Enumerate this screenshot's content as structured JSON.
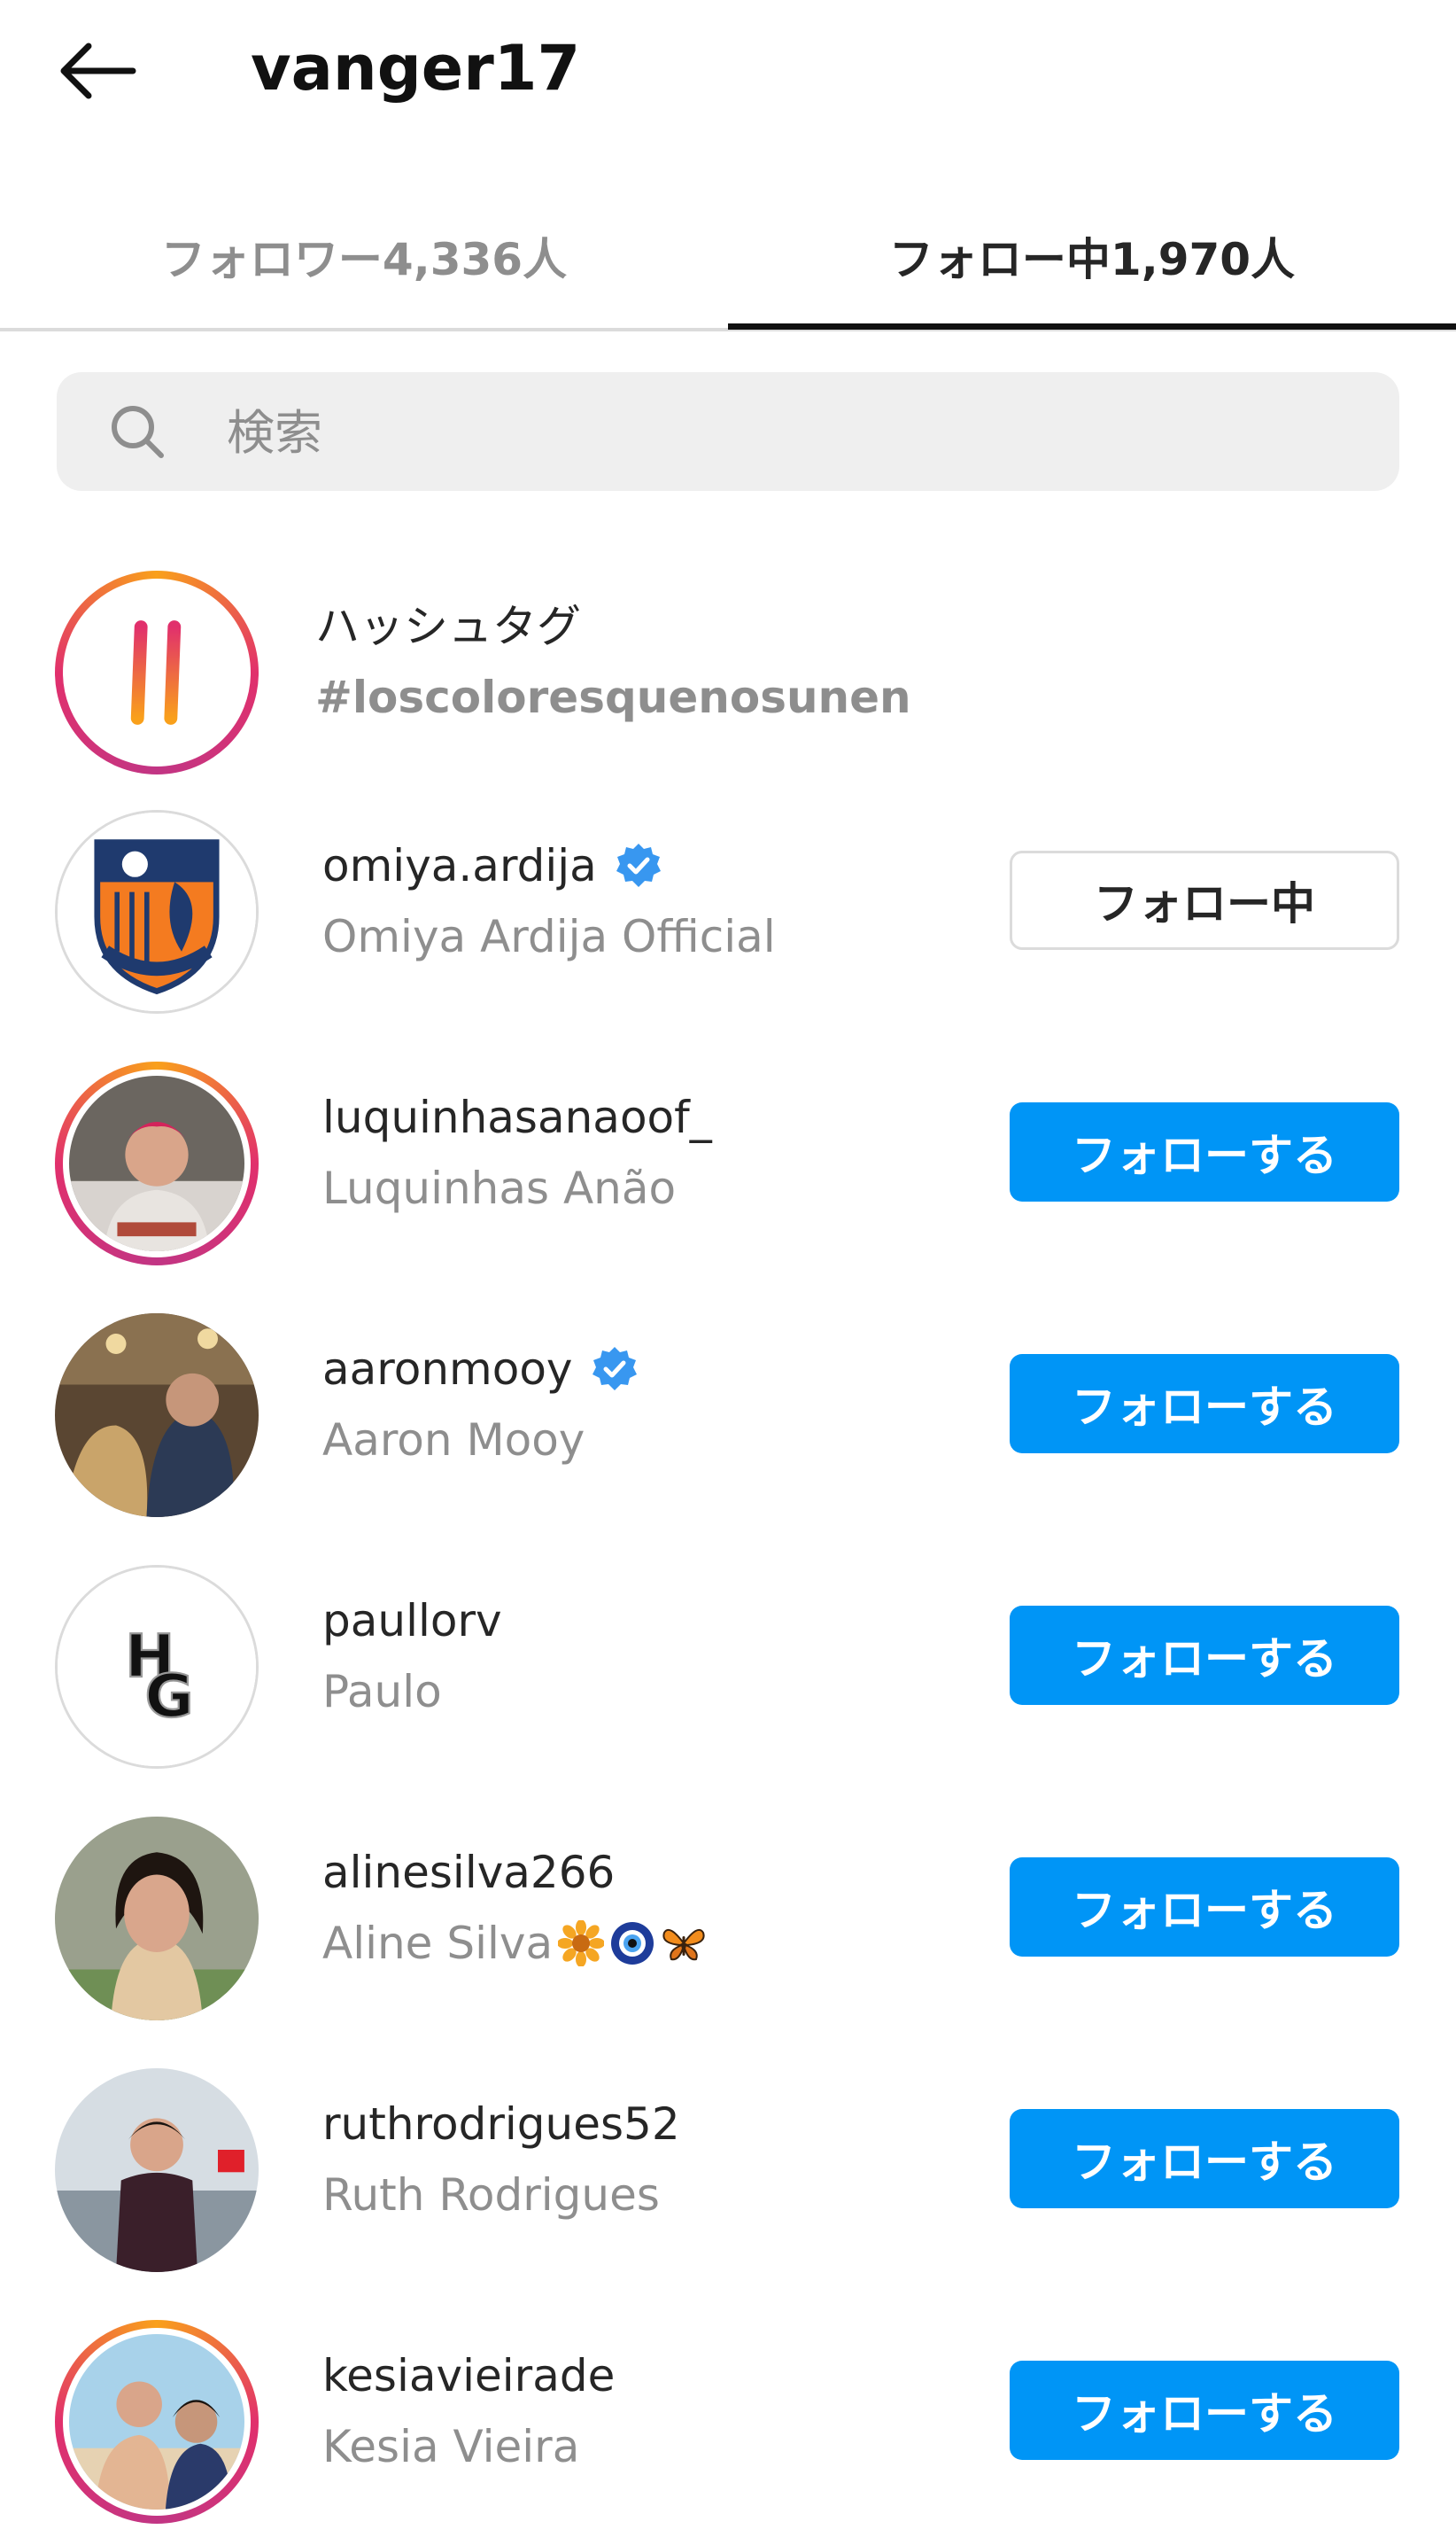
{
  "header": {
    "title": "vanger17",
    "back_icon": "arrow-left-icon"
  },
  "tabs": [
    {
      "label": "フォロワー4,336人",
      "active": false
    },
    {
      "label": "フォロー中1,970人",
      "active": true
    }
  ],
  "search": {
    "placeholder": "検索",
    "value": ""
  },
  "hashtag": {
    "title": "ハッシュタグ",
    "tag": "#loscoloresquenosunen",
    "icon": "hashtag-icon"
  },
  "accounts": [
    {
      "username": "omiya.ardija",
      "fullname": "Omiya Ardija Official",
      "verified": true,
      "button": "フォロー中"
    },
    {
      "username": "luquinhasanaoof_",
      "fullname": "Luquinhas Anão",
      "verified": false,
      "button": "フォローする"
    },
    {
      "username": "aaronmooy",
      "fullname": "Aaron Mooy",
      "verified": true,
      "button": "フォローする"
    },
    {
      "username": "paullorv",
      "fullname": "Paulo",
      "verified": false,
      "button": "フォローする"
    },
    {
      "username": "alinesilva266",
      "fullname": "Aline Silva",
      "verified": false,
      "button": "フォローする"
    },
    {
      "username": "ruthrodrigues52",
      "fullname": "Ruth Rodrigues",
      "verified": false,
      "button": "フォローする"
    },
    {
      "username": "kesiavieirade",
      "fullname": "Kesia Vieira",
      "verified": false,
      "button": "フォローする"
    }
  ],
  "colors": {
    "accent": "#0095f6",
    "text": "#262626",
    "secondary": "#8e8e8e"
  }
}
